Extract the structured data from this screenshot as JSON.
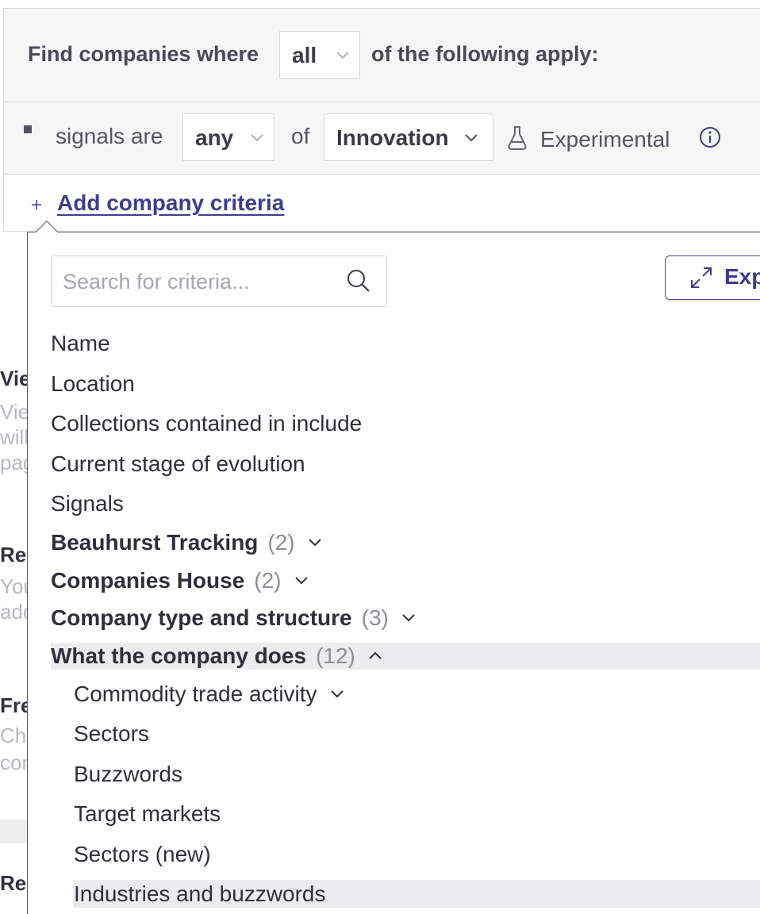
{
  "filter": {
    "prefix": "Find companies where",
    "match_mode": "all",
    "suffix": "of the following apply:",
    "signal_row": {
      "label": "signals are",
      "quantifier": "any",
      "of_text": "of",
      "value": "Innovation",
      "experimental_label": "Experimental"
    },
    "add_criteria_label": "Add company criteria"
  },
  "background_fragments": [
    "Vie",
    "Vie",
    "will",
    "pag",
    "Rec",
    "You",
    "add",
    "Fre",
    "Cho",
    "con",
    "Rer"
  ],
  "dropdown": {
    "search_placeholder": "Search for criteria...",
    "expand_label": "Exp",
    "items": [
      "Name",
      "Location",
      "Collections contained in include",
      "Current stage of evolution",
      "Signals"
    ],
    "groups": [
      {
        "label": "Beauhurst Tracking",
        "count": "(2)"
      },
      {
        "label": "Companies House",
        "count": "(2)"
      },
      {
        "label": "Company type and structure",
        "count": "(3)"
      },
      {
        "label": "What the company does",
        "count": "(12)"
      }
    ],
    "subitems": [
      "Commodity trade activity",
      "Sectors",
      "Buzzwords",
      "Target markets",
      "Sectors (new)",
      "Industries and buzzwords"
    ]
  },
  "icons": {
    "chevron": "chevron-down-icon",
    "flask": "flask-icon",
    "info": "info-icon",
    "search": "search-icon",
    "expand": "expand-icon",
    "plus": "plus-icon"
  },
  "colors": {
    "accent": "#3d3d8f",
    "panel_bg": "#f6f6f7",
    "highlight": "#ececee"
  }
}
